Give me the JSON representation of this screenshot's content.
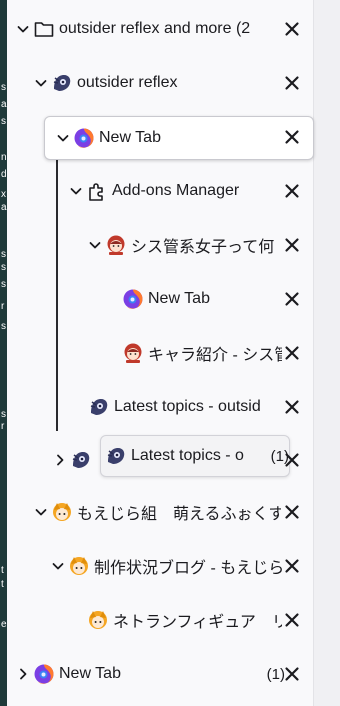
{
  "edge_glyphs": [
    "s",
    "a",
    "s",
    "n",
    "d",
    "x",
    "a",
    "s",
    "s",
    "s",
    "r",
    "s",
    "s",
    "r",
    "t",
    "t",
    "e"
  ],
  "tabs": [
    {
      "label": "outsider reflex and more (2",
      "count": "",
      "twisty": "down",
      "icon": "folder-icon"
    },
    {
      "label": "outsider reflex",
      "count": "",
      "twisty": "down",
      "icon": "outsider-favicon"
    },
    {
      "label": "New Tab",
      "count": "",
      "twisty": "down",
      "icon": "firefox-icon"
    },
    {
      "label": "Add-ons Manager",
      "count": "",
      "twisty": "down",
      "icon": "puzzle-icon"
    },
    {
      "label": "シス管系女子って何",
      "count": "",
      "twisty": "down",
      "icon": "anime-favicon"
    },
    {
      "label": "New Tab",
      "count": "",
      "twisty": "",
      "icon": "firefox-icon"
    },
    {
      "label": "キャラ紹介 - シス管",
      "count": "",
      "twisty": "",
      "icon": "anime-favicon"
    },
    {
      "label": "Latest topics - outsid",
      "count": "",
      "twisty": "",
      "icon": "outsider-favicon"
    },
    {
      "label": "Latest topics - o",
      "count": "(1)",
      "twisty": "right",
      "icon": "outsider-favicon"
    },
    {
      "label": "もえじら組　萌えるふぉくすや",
      "count": "",
      "twisty": "down",
      "icon": "moezilla-favicon"
    },
    {
      "label": "制作状況ブログ - もえじら",
      "count": "",
      "twisty": "down",
      "icon": "moezilla-favicon"
    },
    {
      "label": "ネトランフィギュア　リタ",
      "count": "",
      "twisty": "",
      "icon": "moezilla-favicon"
    },
    {
      "label": "New Tab",
      "count": "(1)",
      "twisty": "right",
      "icon": "firefox-icon"
    }
  ]
}
